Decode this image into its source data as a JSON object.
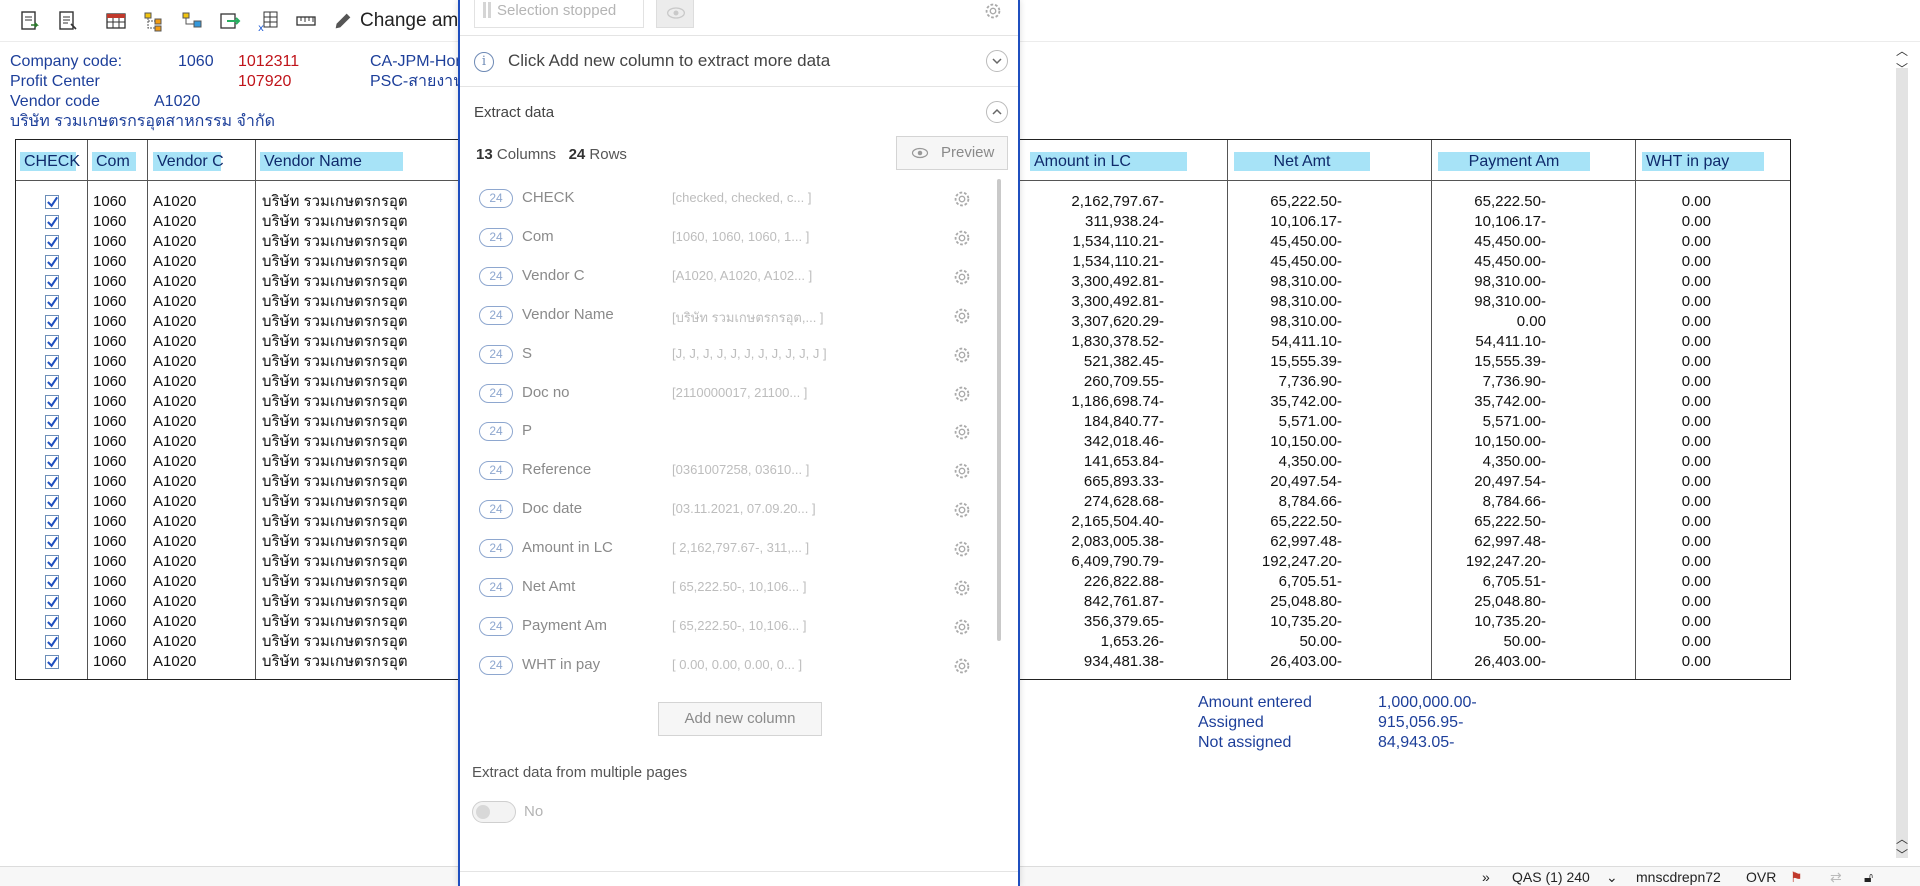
{
  "toolbar": {
    "icons": [
      "document-arrow-icon",
      "document-list-icon",
      "table-grid-icon",
      "tree-expand-icon",
      "tree-collapse-icon",
      "export-icon",
      "excel-x-icon",
      "ruler-icon"
    ],
    "change_label": "Change amc"
  },
  "header": {
    "company_code_label": "Company code:",
    "company_code": "1060",
    "company_code_red": "1012311",
    "company_desc": "CA-JPM-Hon",
    "profit_center_label": "Profit Center",
    "profit_center_red": "107920",
    "profit_center_desc": "PSC-สายงาน",
    "vendor_code_label": "Vendor code",
    "vendor_code": "A1020",
    "vendor_name": "บริษัท รวมเกษตรกรอุตสาหกรรม จำกัด"
  },
  "table": {
    "headers": {
      "check": "CHECK",
      "com": "Com",
      "vendor_c": "Vendor C",
      "vendor_name": "Vendor Name",
      "amount_lc": "Amount in LC",
      "net_amt": "Net Amt",
      "payment_am": "Payment Am",
      "wht": "WHT in pay"
    },
    "rows": [
      {
        "com": "1060",
        "vendor": "A1020",
        "name": "บริษัท รวมเกษตรกรอุต",
        "amount": "2,162,797.67-",
        "net": "65,222.50-",
        "payment": "65,222.50-",
        "wht": "0.00"
      },
      {
        "com": "1060",
        "vendor": "A1020",
        "name": "บริษัท รวมเกษตรกรอุต",
        "amount": "311,938.24-",
        "net": "10,106.17-",
        "payment": "10,106.17-",
        "wht": "0.00"
      },
      {
        "com": "1060",
        "vendor": "A1020",
        "name": "บริษัท รวมเกษตรกรอุต",
        "amount": "1,534,110.21-",
        "net": "45,450.00-",
        "payment": "45,450.00-",
        "wht": "0.00"
      },
      {
        "com": "1060",
        "vendor": "A1020",
        "name": "บริษัท รวมเกษตรกรอุต",
        "amount": "1,534,110.21-",
        "net": "45,450.00-",
        "payment": "45,450.00-",
        "wht": "0.00"
      },
      {
        "com": "1060",
        "vendor": "A1020",
        "name": "บริษัท รวมเกษตรกรอุต",
        "amount": "3,300,492.81-",
        "net": "98,310.00-",
        "payment": "98,310.00-",
        "wht": "0.00"
      },
      {
        "com": "1060",
        "vendor": "A1020",
        "name": "บริษัท รวมเกษตรกรอุต",
        "amount": "3,300,492.81-",
        "net": "98,310.00-",
        "payment": "98,310.00-",
        "wht": "0.00"
      },
      {
        "com": "1060",
        "vendor": "A1020",
        "name": "บริษัท รวมเกษตรกรอุต",
        "amount": "3,307,620.29-",
        "net": "98,310.00-",
        "payment": "0.00",
        "wht": "0.00"
      },
      {
        "com": "1060",
        "vendor": "A1020",
        "name": "บริษัท รวมเกษตรกรอุต",
        "amount": "1,830,378.52-",
        "net": "54,411.10-",
        "payment": "54,411.10-",
        "wht": "0.00"
      },
      {
        "com": "1060",
        "vendor": "A1020",
        "name": "บริษัท รวมเกษตรกรอุต",
        "amount": "521,382.45-",
        "net": "15,555.39-",
        "payment": "15,555.39-",
        "wht": "0.00"
      },
      {
        "com": "1060",
        "vendor": "A1020",
        "name": "บริษัท รวมเกษตรกรอุต",
        "amount": "260,709.55-",
        "net": "7,736.90-",
        "payment": "7,736.90-",
        "wht": "0.00"
      },
      {
        "com": "1060",
        "vendor": "A1020",
        "name": "บริษัท รวมเกษตรกรอุต",
        "amount": "1,186,698.74-",
        "net": "35,742.00-",
        "payment": "35,742.00-",
        "wht": "0.00"
      },
      {
        "com": "1060",
        "vendor": "A1020",
        "name": "บริษัท รวมเกษตรกรอุต",
        "amount": "184,840.77-",
        "net": "5,571.00-",
        "payment": "5,571.00-",
        "wht": "0.00"
      },
      {
        "com": "1060",
        "vendor": "A1020",
        "name": "บริษัท รวมเกษตรกรอุต",
        "amount": "342,018.46-",
        "net": "10,150.00-",
        "payment": "10,150.00-",
        "wht": "0.00"
      },
      {
        "com": "1060",
        "vendor": "A1020",
        "name": "บริษัท รวมเกษตรกรอุต",
        "amount": "141,653.84-",
        "net": "4,350.00-",
        "payment": "4,350.00-",
        "wht": "0.00"
      },
      {
        "com": "1060",
        "vendor": "A1020",
        "name": "บริษัท รวมเกษตรกรอุต",
        "amount": "665,893.33-",
        "net": "20,497.54-",
        "payment": "20,497.54-",
        "wht": "0.00"
      },
      {
        "com": "1060",
        "vendor": "A1020",
        "name": "บริษัท รวมเกษตรกรอุต",
        "amount": "274,628.68-",
        "net": "8,784.66-",
        "payment": "8,784.66-",
        "wht": "0.00"
      },
      {
        "com": "1060",
        "vendor": "A1020",
        "name": "บริษัท รวมเกษตรกรอุต",
        "amount": "2,165,504.40-",
        "net": "65,222.50-",
        "payment": "65,222.50-",
        "wht": "0.00"
      },
      {
        "com": "1060",
        "vendor": "A1020",
        "name": "บริษัท รวมเกษตรกรอุต",
        "amount": "2,083,005.38-",
        "net": "62,997.48-",
        "payment": "62,997.48-",
        "wht": "0.00"
      },
      {
        "com": "1060",
        "vendor": "A1020",
        "name": "บริษัท รวมเกษตรกรอุต",
        "amount": "6,409,790.79-",
        "net": "192,247.20-",
        "payment": "192,247.20-",
        "wht": "0.00"
      },
      {
        "com": "1060",
        "vendor": "A1020",
        "name": "บริษัท รวมเกษตรกรอุต",
        "amount": "226,822.88-",
        "net": "6,705.51-",
        "payment": "6,705.51-",
        "wht": "0.00"
      },
      {
        "com": "1060",
        "vendor": "A1020",
        "name": "บริษัท รวมเกษตรกรอุต",
        "amount": "842,761.87-",
        "net": "25,048.80-",
        "payment": "25,048.80-",
        "wht": "0.00"
      },
      {
        "com": "1060",
        "vendor": "A1020",
        "name": "บริษัท รวมเกษตรกรอุต",
        "amount": "356,379.65-",
        "net": "10,735.20-",
        "payment": "10,735.20-",
        "wht": "0.00"
      },
      {
        "com": "1060",
        "vendor": "A1020",
        "name": "บริษัท รวมเกษตรกรอุต",
        "amount": "1,653.26-",
        "net": "50.00-",
        "payment": "50.00-",
        "wht": "0.00"
      },
      {
        "com": "1060",
        "vendor": "A1020",
        "name": "บริษัท รวมเกษตรกรอุต",
        "amount": "934,481.38-",
        "net": "26,403.00-",
        "payment": "26,403.00-",
        "wht": "0.00"
      }
    ]
  },
  "totals": {
    "entered_label": "Amount entered",
    "entered_value": "1,000,000.00-",
    "assigned_label": "Assigned",
    "assigned_value": "915,056.95-",
    "not_assigned_label": "Not assigned",
    "not_assigned_value": "84,943.05-"
  },
  "statusbar": {
    "system": "QAS (1) 240",
    "server": "mnscdrepn72",
    "mode": "OVR"
  },
  "panel": {
    "selection_status": "Selection stopped",
    "info_text": "Click Add new column to extract more data",
    "extract_title": "Extract data",
    "columns_count": "13",
    "columns_label": "Columns",
    "rows_count": "24",
    "rows_label": "Rows",
    "preview_label": "Preview",
    "columns": [
      {
        "count": "24",
        "name": "CHECK",
        "preview": "[checked, checked, c... ]"
      },
      {
        "count": "24",
        "name": "Com",
        "preview": "[1060, 1060, 1060, 1... ]"
      },
      {
        "count": "24",
        "name": "Vendor C",
        "preview": "[A1020, A1020, A102... ]"
      },
      {
        "count": "24",
        "name": "Vendor Name",
        "preview": "[บริษัท รวมเกษตรกรอุต,... ]"
      },
      {
        "count": "24",
        "name": "S",
        "preview": "[J, J, J, J, J, J, J, J, J, J, J ]"
      },
      {
        "count": "24",
        "name": "Doc no",
        "preview": "[2110000017, 21100... ]"
      },
      {
        "count": "24",
        "name": "P",
        "preview": ""
      },
      {
        "count": "24",
        "name": "Reference",
        "preview": "[0361007258, 03610... ]"
      },
      {
        "count": "24",
        "name": "Doc date",
        "preview": "[03.11.2021, 07.09.20... ]"
      },
      {
        "count": "24",
        "name": "Amount in LC",
        "preview": "[ 2,162,797.67-, 311,... ]"
      },
      {
        "count": "24",
        "name": "Net Amt",
        "preview": "[ 65,222.50-, 10,106... ]"
      },
      {
        "count": "24",
        "name": "Payment Am",
        "preview": "[ 65,222.50-, 10,106... ]"
      },
      {
        "count": "24",
        "name": "WHT in pay",
        "preview": "[ 0.00, 0.00, 0.00, 0... ]"
      }
    ],
    "add_column_label": "Add new column",
    "multi_page_label": "Extract data from multiple pages",
    "toggle_label": "No",
    "toggle_on": false
  }
}
